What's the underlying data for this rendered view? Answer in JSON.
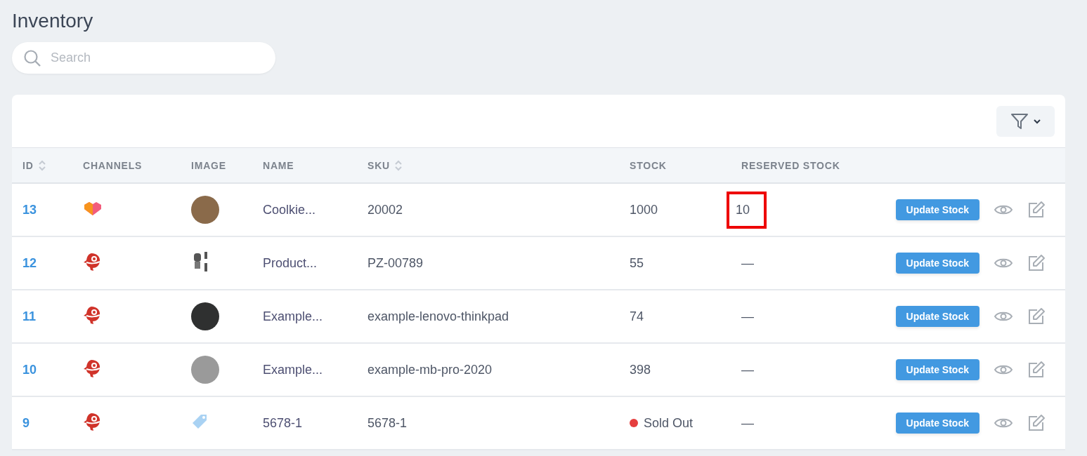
{
  "page": {
    "title": "Inventory"
  },
  "search": {
    "placeholder": "Search"
  },
  "table": {
    "columns": [
      {
        "label": "ID",
        "sortable": true
      },
      {
        "label": "CHANNELS",
        "sortable": false
      },
      {
        "label": "IMAGE",
        "sortable": false
      },
      {
        "label": "NAME",
        "sortable": false
      },
      {
        "label": "SKU",
        "sortable": true
      },
      {
        "label": "STOCK",
        "sortable": false
      },
      {
        "label": "RESERVED STOCK",
        "sortable": false
      }
    ],
    "rows": [
      {
        "id": "13",
        "name": "Coolkie...",
        "sku": "20002",
        "stock": {
          "kind": "number",
          "text": "1000"
        },
        "reserved": "10",
        "highlighted": true,
        "button": "Update Stock"
      },
      {
        "id": "12",
        "name": "Product...",
        "sku": "PZ-00789",
        "stock": {
          "kind": "number",
          "text": "55"
        },
        "reserved": "—",
        "highlighted": false,
        "button": "Update Stock"
      },
      {
        "id": "11",
        "name": "Example...",
        "sku": "example-lenovo-thinkpad",
        "stock": {
          "kind": "number",
          "text": "74"
        },
        "reserved": "—",
        "highlighted": false,
        "button": "Update Stock"
      },
      {
        "id": "10",
        "name": "Example...",
        "sku": "example-mb-pro-2020",
        "stock": {
          "kind": "number",
          "text": "398"
        },
        "reserved": "—",
        "highlighted": false,
        "button": "Update Stock"
      },
      {
        "id": "9",
        "name": "5678-1",
        "sku": "5678-1",
        "stock": {
          "kind": "status",
          "text": "Sold Out",
          "color": "#e53e3e"
        },
        "reserved": "—",
        "highlighted": false,
        "button": "Update Stock"
      }
    ]
  }
}
